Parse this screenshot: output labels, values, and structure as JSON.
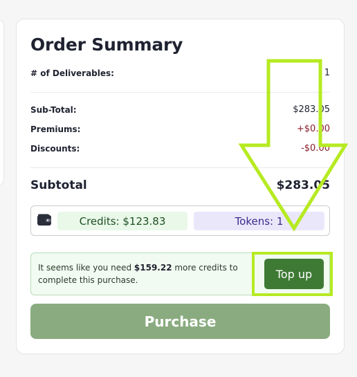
{
  "order_summary": {
    "title": "Order Summary",
    "deliverables_label": "# of Deliverables:",
    "deliverables_value": "1",
    "subtotal_line_label": "Sub-Total:",
    "subtotal_line_value": "$283.05",
    "premiums_label": "Premiums:",
    "premiums_value": "+$0.00",
    "discounts_label": "Discounts:",
    "discounts_value": "-$0.00",
    "subtotal_label": "Subtotal",
    "subtotal_value": "$283.05"
  },
  "wallet": {
    "icon": "wallet-icon",
    "credits_label": "Credits: $123.83",
    "tokens_label": "Tokens: 1"
  },
  "notice": {
    "text_prefix": "It seems like you need ",
    "amount": "$159.22",
    "text_suffix": " more credits to complete this purchase.",
    "topup_label": "Top up"
  },
  "purchase": {
    "label": "Purchase"
  },
  "colors": {
    "accent_green": "#3f7a35",
    "purchase_disabled": "#8aab80",
    "negative_red": "#8a1c2b",
    "annotation_highlight": "#b6ea22"
  }
}
